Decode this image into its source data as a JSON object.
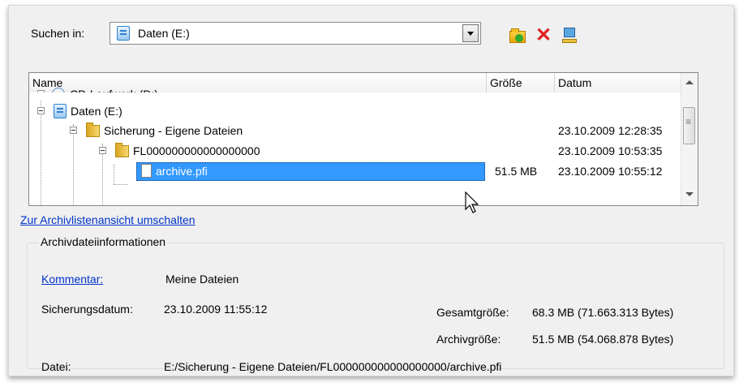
{
  "search": {
    "label": "Suchen in:",
    "selected": "Daten (E:)"
  },
  "toolbar": {
    "icons": [
      "folder-new-icon",
      "delete-icon",
      "network-drive-icon"
    ]
  },
  "list": {
    "columns": [
      "Name",
      "Größe",
      "Datum"
    ],
    "rows": [
      {
        "name": "CD-Laufwerk (D:)",
        "size": "",
        "date": ""
      },
      {
        "name": "Daten (E:)",
        "size": "",
        "date": ""
      },
      {
        "name": "Sicherung - Eigene Dateien",
        "size": "",
        "date": "23.10.2009 12:28:35"
      },
      {
        "name": "FL000000000000000000",
        "size": "",
        "date": "23.10.2009 10:53:35"
      },
      {
        "name": "archive.pfi",
        "size": "51.5 MB",
        "date": "23.10.2009 10:55:12"
      }
    ]
  },
  "switch_link": "Zur Archivlistenansicht umschalten",
  "info": {
    "group_title": "Archivdateiinformationen",
    "comment_label": "Kommentar:",
    "comment_value": "Meine Dateien",
    "date_label": "Sicherungsdatum:",
    "date_value": "23.10.2009 11:55:12",
    "total_label": "Gesamtgröße:",
    "total_value": "68.3 MB (71.663.313 Bytes)",
    "archive_label": "Archivgröße:",
    "archive_value": "51.5 MB (54.068.878 Bytes)",
    "file_label": "Datei:",
    "file_value": "E:/Sicherung - Eigene Dateien/FL000000000000000000/archive.pfi"
  },
  "colors": {
    "selection": "#3399ff",
    "link": "#0033cc"
  }
}
